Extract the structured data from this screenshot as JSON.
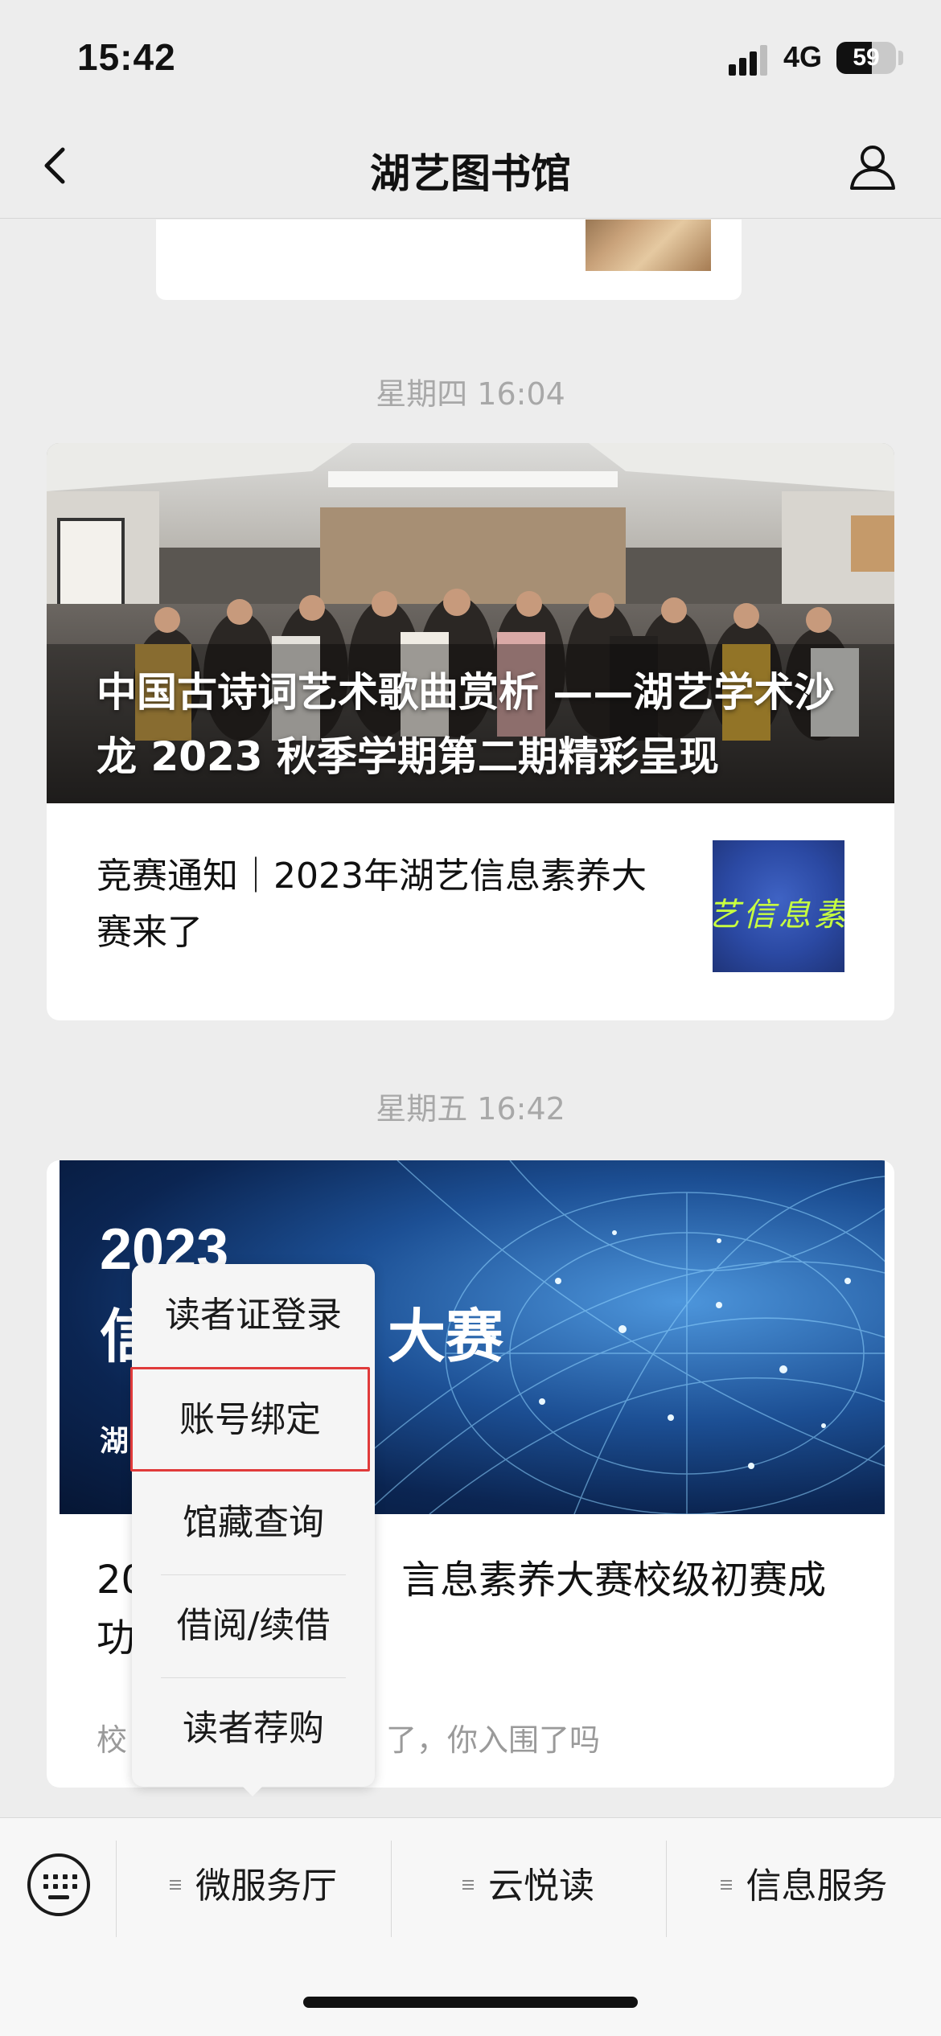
{
  "status_bar": {
    "time": "15:42",
    "network": "4G",
    "battery": "59",
    "battery_level_percent": 59
  },
  "nav": {
    "title": "湖艺图书馆",
    "icons": {
      "back": "chevron-left-icon",
      "profile": "person-icon"
    }
  },
  "feed": {
    "messages": [
      {
        "timestamp": "星期四 16:04",
        "hero_headline": "中国古诗词艺术歌曲赏析 ——湖艺学术沙龙 2023 秋季学期第二期精彩呈现",
        "sub_article": {
          "title": "竞赛通知｜2023年湖艺信息素养大赛来了",
          "thumbnail_text": "艺信息素养"
        }
      },
      {
        "timestamp": "星期五 16:42",
        "hero_text_line1": "2023",
        "hero_text_line2": "信",
        "hero_text_line2_tail": "大赛",
        "hero_text_line3": "湖",
        "title_visible_start": "20",
        "title_visible_end": "言息素养大赛校级初赛成",
        "title_line2_visible": "功",
        "desc_visible_start": "校",
        "desc_visible_end": "了，你入围了吗"
      }
    ]
  },
  "popup_menu": {
    "items": [
      "读者证登录",
      "账号绑定",
      "馆藏查询",
      "借阅/续借",
      "读者荐购"
    ],
    "highlighted_index": 1,
    "highlight_color": "#e03a3a"
  },
  "tab_bar": {
    "keyboard_icon": "keyboard-icon",
    "tabs": [
      "微服务厅",
      "云悦读",
      "信息服务"
    ]
  }
}
